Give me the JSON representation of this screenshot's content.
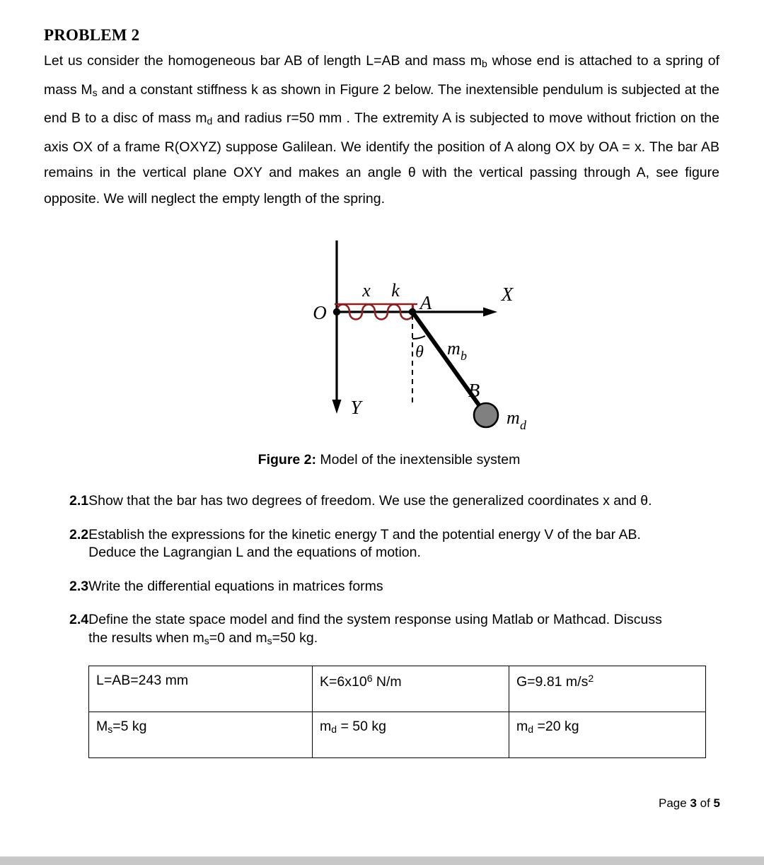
{
  "document": {
    "heading": "PROBLEM 2",
    "intro_paragraph": "Let us consider the homogeneous bar AB of length L=AB and mass m|b| whose end is attached to a spring of mass M|s| and a constant stiffness k as shown in Figure 2 below. The inextensible pendulum is subjected at the end B to a disc of mass m|d| and radius r=50 mm . The extremity A is subjected to move without friction on the axis OX of a frame R(OXYZ) suppose Galilean. We identify the position of A along OX by OA = x. The bar AB remains in the vertical plane OXY and makes an angle θ with the vertical passing through A, see figure opposite. We will neglect the empty length of the spring."
  },
  "figure": {
    "caption_label": "Figure 2:",
    "caption_text": " Model of the inextensible system",
    "labels": {
      "origin": "O",
      "x_axis": "X",
      "y_axis": "Y",
      "point_a": "A",
      "point_b": "B",
      "displacement": "x",
      "stiffness": "k",
      "angle": "θ",
      "bar_mass": "m",
      "bar_mass_sub": "b",
      "disc_mass": "m",
      "disc_mass_sub": "d"
    },
    "colors": {
      "spring": "#8b2020",
      "disc_fill": "#808080",
      "axis": "#000000",
      "bar": "#000000"
    }
  },
  "questions": [
    {
      "number": "2.1",
      "lines": [
        "Show that the bar has two degrees of freedom. We use the generalized coordinates x and θ."
      ]
    },
    {
      "number": "2.2",
      "lines": [
        "Establish the expressions for the kinetic energy T and the potential energy V of the bar AB.",
        "Deduce the Lagrangian L and the equations of motion."
      ]
    },
    {
      "number": "2.3",
      "lines": [
        "Write the differential equations in matrices forms"
      ]
    },
    {
      "number": "2.4",
      "lines": [
        "Define the state space model and find the system response using Matlab or Mathcad. Discuss",
        "the results when m|s|=0 and m|s|=50 kg."
      ]
    }
  ],
  "parameters_table": {
    "rows": [
      [
        {
          "text": "L=AB=243 mm"
        },
        {
          "text": "K=6x10^6^ N/m"
        },
        {
          "text": "G=9.81 m/s^2^"
        }
      ],
      [
        {
          "text": "M|s|=5 kg"
        },
        {
          "text": "m|d| = 50 kg"
        },
        {
          "text": "m|d| =20 kg"
        }
      ]
    ]
  },
  "footer": {
    "prefix": "Page ",
    "current_page": "3",
    "middle": " of ",
    "total_pages": "5"
  }
}
